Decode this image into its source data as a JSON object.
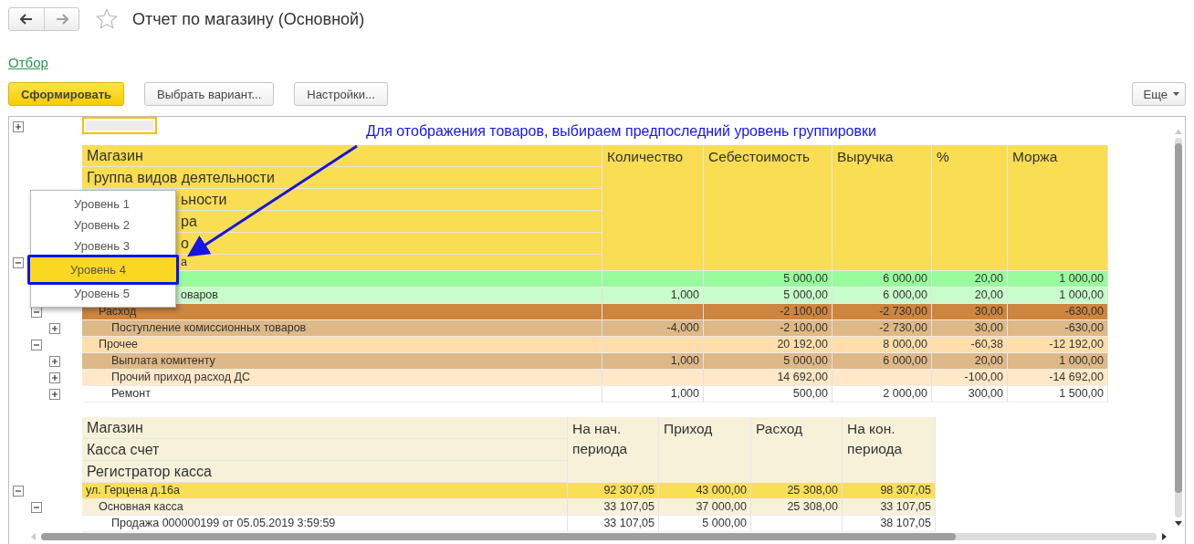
{
  "window": {
    "title": "Отчет по магазину (Основной)",
    "favorite": false
  },
  "nav": {
    "back_disabled": false,
    "forward_disabled": true
  },
  "filter_link": "Отбор",
  "toolbar": {
    "buttons": [
      {
        "label": "Сформировать",
        "kind": "primary"
      },
      {
        "label": "Выбрать вариант...",
        "kind": "normal"
      },
      {
        "label": "Настройки...",
        "kind": "normal"
      }
    ],
    "more": "Еще"
  },
  "report": {
    "settings_expanded": false,
    "annotation": "Для отображения товаров, выбираем предпоследний уровень группировки",
    "grouping_headers": [
      {
        "text": "Магазин",
        "covered": false
      },
      {
        "text": "Группа видов деятельности",
        "covered": false
      },
      {
        "text": "ьности",
        "covered": true
      },
      {
        "text": "ра",
        "covered": true
      },
      {
        "text": "о",
        "covered": true
      }
    ],
    "columns": [
      "Количество",
      "Себестоимость",
      "Выручка",
      "%",
      "Моржа"
    ],
    "rows": [
      {
        "label": "а",
        "covered": true,
        "expanded": true,
        "color": "#f9dd52",
        "children": [
          {
            "color": "#98fb9c",
            "values": [
              {
                "kind": "cost",
                "text": "5 000,00"
              },
              {
                "kind": "revenue",
                "text": "6 000,00"
              },
              {
                "kind": "percent",
                "text": "20,00"
              },
              {
                "kind": "margin",
                "text": "1 000,00"
              }
            ],
            "children": [
              {
                "label": "оваров",
                "covered": true,
                "color": "#c8fcca",
                "values": [
                  {
                    "kind": "quantity",
                    "text": "1,000"
                  },
                  {
                    "kind": "cost",
                    "text": "5 000,00"
                  },
                  {
                    "kind": "revenue",
                    "text": "6 000,00"
                  },
                  {
                    "kind": "percent",
                    "text": "20,00"
                  },
                  {
                    "kind": "margin",
                    "text": "1 000,00"
                  }
                ]
              }
            ]
          },
          {
            "label": "Расход",
            "covered": false,
            "expanded": true,
            "color": "#cd853f",
            "values": [
              {
                "kind": "cost",
                "text": "-2 100,00"
              },
              {
                "kind": "revenue",
                "text": "-2 730,00"
              },
              {
                "kind": "percent",
                "text": "30,00"
              },
              {
                "kind": "margin",
                "text": "-630,00"
              }
            ],
            "children": [
              {
                "label": "Поступление комиссионных товаров",
                "covered": false,
                "expanded": false,
                "color": "#deb887",
                "values": [
                  {
                    "kind": "quantity",
                    "text": "-4,000"
                  },
                  {
                    "kind": "cost",
                    "text": "-2 100,00"
                  },
                  {
                    "kind": "revenue",
                    "text": "-2 730,00"
                  },
                  {
                    "kind": "percent",
                    "text": "30,00"
                  },
                  {
                    "kind": "margin",
                    "text": "-630,00"
                  }
                ]
              }
            ]
          },
          {
            "label": "Прочее",
            "covered": false,
            "expanded": true,
            "color": "#ffdeac",
            "values": [
              {
                "kind": "cost",
                "text": "20 192,00"
              },
              {
                "kind": "revenue",
                "text": "8 000,00"
              },
              {
                "kind": "percent",
                "text": "-60,38"
              },
              {
                "kind": "margin",
                "text": "-12 192,00"
              }
            ],
            "children": [
              {
                "label": "Выплата комитенту",
                "covered": false,
                "expanded": false,
                "color": "#deb887",
                "values": [
                  {
                    "kind": "quantity",
                    "text": "1,000"
                  },
                  {
                    "kind": "cost",
                    "text": "5 000,00"
                  },
                  {
                    "kind": "revenue",
                    "text": "6 000,00"
                  },
                  {
                    "kind": "percent",
                    "text": "20,00"
                  },
                  {
                    "kind": "margin",
                    "text": "1 000,00"
                  }
                ]
              },
              {
                "label": "Прочий приход расход ДС",
                "covered": false,
                "expanded": false,
                "color": "#ffe8c8",
                "values": [
                  {
                    "kind": "cost",
                    "text": "14 692,00"
                  },
                  {
                    "kind": "percent",
                    "text": "-100,00"
                  },
                  {
                    "kind": "margin",
                    "text": "-14 692,00"
                  }
                ]
              },
              {
                "label": "Ремонт",
                "covered": false,
                "expanded": false,
                "color": "#ffffff",
                "values": [
                  {
                    "kind": "quantity",
                    "text": "1,000"
                  },
                  {
                    "kind": "cost",
                    "text": "500,00"
                  },
                  {
                    "kind": "revenue",
                    "text": "2 000,00"
                  },
                  {
                    "kind": "percent",
                    "text": "300,00"
                  },
                  {
                    "kind": "margin",
                    "text": "1 500,00"
                  }
                ]
              }
            ]
          }
        ]
      }
    ]
  },
  "level_menu": {
    "items": [
      {
        "label": "Уровень 1",
        "selected": false
      },
      {
        "label": "Уровень 2",
        "selected": false
      },
      {
        "label": "Уровень 3",
        "selected": false
      },
      {
        "label": "Уровень 4",
        "selected": true
      },
      {
        "label": "Уровень 5",
        "selected": false
      }
    ]
  },
  "cash_table": {
    "grouping_headers": [
      "Магазин",
      "Касса счет",
      "Регистратор касса"
    ],
    "columns": [
      "На нач. периода",
      "Приход",
      "Расход",
      "На кон. периода"
    ],
    "rows": [
      {
        "label": "ул. Герцена д.16а",
        "expanded": true,
        "color": "#f9df56",
        "values": [
          {
            "kind": "opening",
            "text": "92 307,05"
          },
          {
            "kind": "income",
            "text": "43 000,00"
          },
          {
            "kind": "expense",
            "text": "25 308,00"
          },
          {
            "kind": "closing",
            "text": "98 307,05"
          }
        ],
        "children": [
          {
            "label": "Основная касса",
            "expanded": true,
            "color": "#f7f1da",
            "values": [
              {
                "kind": "opening",
                "text": "33 107,05"
              },
              {
                "kind": "income",
                "text": "37 000,00"
              },
              {
                "kind": "expense",
                "text": "25 308,00"
              },
              {
                "kind": "closing",
                "text": "33 107,05"
              }
            ],
            "children": [
              {
                "label": "Продажа 000000199 от 05.05.2019 3:59:59",
                "color": "#ffffff",
                "values": [
                  {
                    "kind": "opening",
                    "text": "33 107,05"
                  },
                  {
                    "kind": "income",
                    "text": "5 000,00"
                  },
                  {
                    "kind": "closing",
                    "text": "38 107,05"
                  }
                ]
              }
            ]
          }
        ]
      }
    ]
  }
}
